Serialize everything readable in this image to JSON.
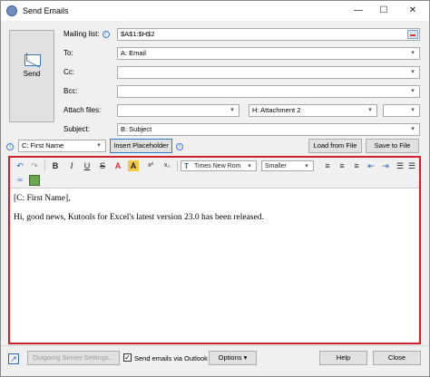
{
  "window": {
    "title": "Send Emails",
    "min_glyph": "—",
    "max_glyph": "☐",
    "close_glyph": "✕"
  },
  "send": {
    "label": "Send"
  },
  "fields": {
    "mailing_list": {
      "label": "Mailing list:",
      "value": "$A$1:$H$2"
    },
    "to": {
      "label": "To:",
      "value": "A: Email"
    },
    "cc": {
      "label": "Cc:",
      "value": ""
    },
    "bcc": {
      "label": "Bcc:",
      "value": ""
    },
    "attach": {
      "label": "Attach files:",
      "value": "",
      "value2": "H: Attachment 2",
      "value3": ""
    },
    "subject": {
      "label": "Subject:",
      "value": "B: Subject"
    }
  },
  "placeholder": {
    "selected": "C: First Name",
    "insert_label": "Insert Placeholder"
  },
  "file_buttons": {
    "load": "Load from File",
    "save": "Save to File"
  },
  "toolbar": {
    "undo": "↶",
    "redo": "↷",
    "bold": "B",
    "italic": "I",
    "underline": "U",
    "strike": "S",
    "font_color": "A",
    "highlight": "A",
    "superscript": "x²",
    "subscript": "x₂",
    "font_name": "Times New Rom",
    "font_size": "Smaller"
  },
  "document": {
    "line1": "[C: First Name],",
    "line2": "Hi, good news, Kutools for Excel's latest version 23.0 has been released."
  },
  "footer": {
    "outgoing": "Outgoing Server Settings...",
    "send_via_outlook": "Send emails via Outlook",
    "checked_glyph": "✓",
    "options": "Options",
    "help": "Help",
    "close": "Close"
  },
  "colors": {
    "editor_border": "#d2202a",
    "accent": "#2b7bd6"
  }
}
